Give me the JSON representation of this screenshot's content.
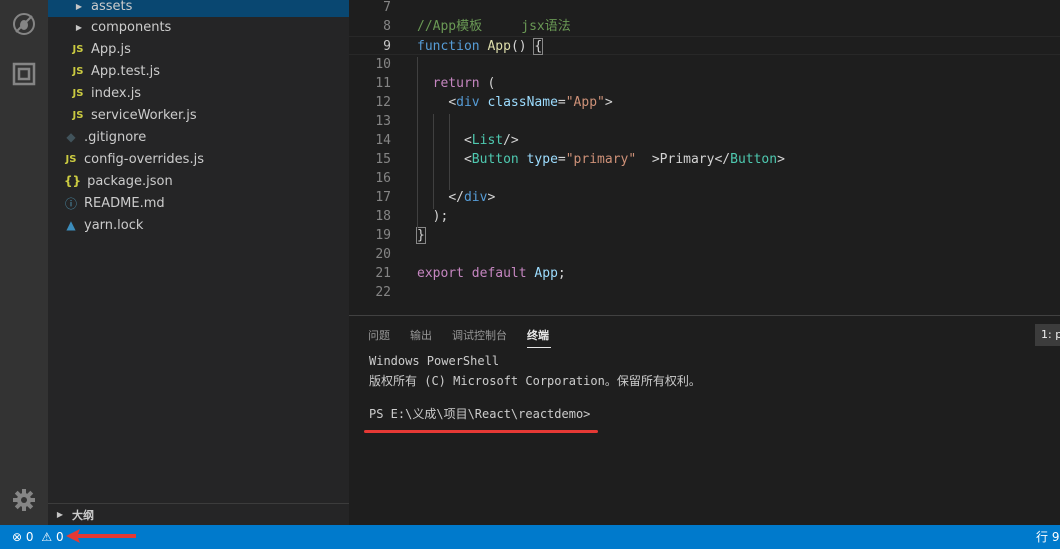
{
  "explorer": {
    "items": [
      {
        "label": "assets",
        "kind": "folder",
        "selected": true
      },
      {
        "label": "components",
        "kind": "folder"
      },
      {
        "label": "App.js",
        "kind": "js",
        "icon_text": "JS"
      },
      {
        "label": "App.test.js",
        "kind": "js",
        "icon_text": "JS"
      },
      {
        "label": "index.js",
        "kind": "js",
        "icon_text": "JS"
      },
      {
        "label": "serviceWorker.js",
        "kind": "js",
        "icon_text": "JS"
      },
      {
        "label": ".gitignore",
        "kind": "git",
        "icon_text": "◆"
      },
      {
        "label": "config-overrides.js",
        "kind": "js",
        "icon_text": "JS"
      },
      {
        "label": "package.json",
        "kind": "json",
        "icon_text": "{}"
      },
      {
        "label": "README.md",
        "kind": "info",
        "icon_text": "ⓘ"
      },
      {
        "label": "yarn.lock",
        "kind": "yarn",
        "icon_text": "▲"
      }
    ],
    "outline_label": "大纲"
  },
  "editor": {
    "active_line": 9,
    "lines": [
      {
        "n": "7",
        "tokens": []
      },
      {
        "n": "8",
        "tokens": [
          {
            "t": "//App模板     jsx语法",
            "c": "comment"
          }
        ]
      },
      {
        "n": "9",
        "tokens": [
          {
            "t": "function",
            "c": "keyword"
          },
          {
            "t": " ",
            "c": "punct"
          },
          {
            "t": "App",
            "c": "func"
          },
          {
            "t": "() ",
            "c": "punct"
          },
          {
            "t": "{",
            "c": "punct bracket"
          }
        ]
      },
      {
        "n": "10",
        "tokens": []
      },
      {
        "n": "11",
        "tokens": [
          {
            "t": "  ",
            "c": "punct"
          },
          {
            "t": "return",
            "c": "ctrl"
          },
          {
            "t": " (",
            "c": "punct"
          }
        ]
      },
      {
        "n": "12",
        "tokens": [
          {
            "t": "    ",
            "c": "punct"
          },
          {
            "t": "<",
            "c": "punct"
          },
          {
            "t": "div",
            "c": "tag"
          },
          {
            "t": " ",
            "c": "punct"
          },
          {
            "t": "className",
            "c": "attr"
          },
          {
            "t": "=",
            "c": "punct"
          },
          {
            "t": "\"App\"",
            "c": "str"
          },
          {
            "t": ">",
            "c": "punct"
          }
        ]
      },
      {
        "n": "13",
        "tokens": []
      },
      {
        "n": "14",
        "tokens": [
          {
            "t": "      ",
            "c": "punct"
          },
          {
            "t": "<",
            "c": "punct"
          },
          {
            "t": "List",
            "c": "comp"
          },
          {
            "t": "/>",
            "c": "punct"
          }
        ]
      },
      {
        "n": "15",
        "tokens": [
          {
            "t": "      ",
            "c": "punct"
          },
          {
            "t": "<",
            "c": "punct"
          },
          {
            "t": "Button",
            "c": "comp"
          },
          {
            "t": " ",
            "c": "punct"
          },
          {
            "t": "type",
            "c": "attr"
          },
          {
            "t": "=",
            "c": "punct"
          },
          {
            "t": "\"primary\"",
            "c": "str"
          },
          {
            "t": "  >",
            "c": "punct"
          },
          {
            "t": "Primary",
            "c": "text"
          },
          {
            "t": "</",
            "c": "punct"
          },
          {
            "t": "Button",
            "c": "comp"
          },
          {
            "t": ">",
            "c": "punct"
          }
        ]
      },
      {
        "n": "16",
        "tokens": []
      },
      {
        "n": "17",
        "tokens": [
          {
            "t": "    ",
            "c": "punct"
          },
          {
            "t": "</",
            "c": "punct"
          },
          {
            "t": "div",
            "c": "tag"
          },
          {
            "t": ">",
            "c": "punct"
          }
        ]
      },
      {
        "n": "18",
        "tokens": [
          {
            "t": "  );",
            "c": "punct"
          }
        ]
      },
      {
        "n": "19",
        "tokens": [
          {
            "t": "}",
            "c": "punct bracket"
          }
        ]
      },
      {
        "n": "20",
        "tokens": []
      },
      {
        "n": "21",
        "tokens": [
          {
            "t": "export",
            "c": "ctrl"
          },
          {
            "t": " ",
            "c": "punct"
          },
          {
            "t": "default",
            "c": "ctrl"
          },
          {
            "t": " ",
            "c": "punct"
          },
          {
            "t": "App",
            "c": "var"
          },
          {
            "t": ";",
            "c": "punct"
          }
        ]
      },
      {
        "n": "22",
        "tokens": []
      }
    ]
  },
  "panel": {
    "tabs": [
      {
        "label": "问题"
      },
      {
        "label": "输出"
      },
      {
        "label": "调试控制台"
      },
      {
        "label": "终端",
        "active": true
      }
    ],
    "terminal_select": "1: p",
    "terminal_lines": [
      "Windows PowerShell",
      "版权所有 (C) Microsoft Corporation。保留所有权利。",
      "",
      "PS E:\\义成\\项目\\React\\reactdemo>"
    ]
  },
  "statusbar": {
    "errors": "0",
    "warnings": "0",
    "position": "行 9"
  },
  "colors": {
    "activity_bar": "#333333",
    "sidebar": "#252526",
    "editor": "#1e1e1e",
    "statusbar": "#007acc",
    "annotation_red": "#e53935"
  }
}
